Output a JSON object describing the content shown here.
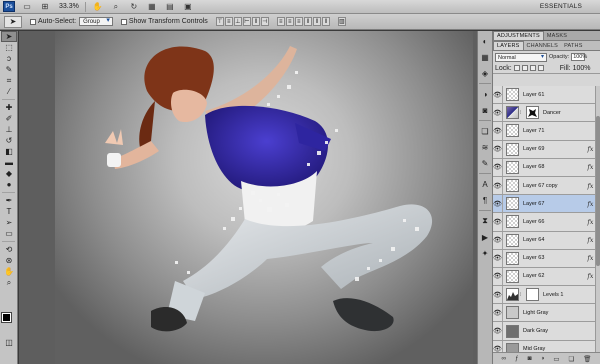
{
  "app": {
    "logo": "Ps",
    "zoom": "33.3%",
    "workspace": "ESSENTIALS"
  },
  "options": {
    "auto_select_label": "Auto-Select:",
    "auto_select_value": "Group",
    "show_transform_label": "Show Transform Controls"
  },
  "panels": {
    "top_tabs": [
      "ADJUSTMENTS",
      "MASKS"
    ],
    "layer_tabs": [
      "LAYERS",
      "CHANNELS",
      "PATHS"
    ],
    "blend_mode": "Normal",
    "opacity_label": "Opacity:",
    "opacity_value": "100%",
    "lock_label": "Lock:",
    "fill_label": "Fill:",
    "fill_value": "100%"
  },
  "layers": [
    {
      "name": "Layer 61",
      "thumb": "checker",
      "fx": false,
      "selected": false
    },
    {
      "name": "Dancer",
      "thumb": "dancer",
      "mask": true,
      "fx": false,
      "selected": false
    },
    {
      "name": "Layer 71",
      "thumb": "checker",
      "fx": false,
      "selected": false
    },
    {
      "name": "Layer 69",
      "thumb": "checker",
      "fx": true,
      "selected": false
    },
    {
      "name": "Layer 68",
      "thumb": "checker",
      "fx": true,
      "selected": false
    },
    {
      "name": "Layer 67 copy",
      "thumb": "checker",
      "fx": true,
      "selected": false
    },
    {
      "name": "Layer 67",
      "thumb": "checker",
      "fx": true,
      "selected": true
    },
    {
      "name": "Layer 66",
      "thumb": "checker",
      "fx": true,
      "selected": false
    },
    {
      "name": "Layer 64",
      "thumb": "checker",
      "fx": true,
      "selected": false
    },
    {
      "name": "Layer 63",
      "thumb": "checker",
      "fx": true,
      "selected": false
    },
    {
      "name": "Layer 62",
      "thumb": "checker",
      "fx": true,
      "selected": false
    },
    {
      "name": "Levels 1",
      "thumb": "levels",
      "mask": true,
      "fx": false,
      "selected": false
    },
    {
      "name": "Light Gray",
      "thumb": "fill-light",
      "fx": false,
      "selected": false
    },
    {
      "name": "Dark Gray",
      "thumb": "fill-dark",
      "fx": false,
      "selected": false
    },
    {
      "name": "Mid Gray",
      "thumb": "fill-mid",
      "fx": false,
      "selected": false
    }
  ],
  "fx_label": "fx",
  "colors": {
    "shirt": "#3a2fb5",
    "hair": "#8a3a1c",
    "selected_layer": "#b7cbe8"
  }
}
